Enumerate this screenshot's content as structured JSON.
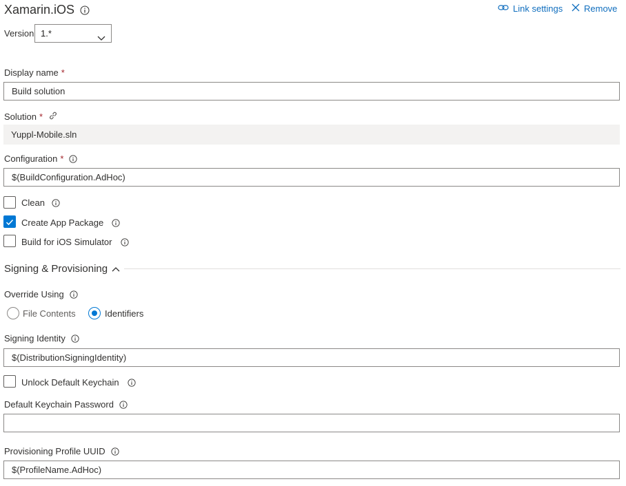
{
  "task": {
    "title": "Xamarin.iOS",
    "link_settings": "Link settings",
    "remove": "Remove"
  },
  "version": {
    "label": "Version",
    "value": "1.*"
  },
  "display_name": {
    "label": "Display name",
    "required_mark": "*",
    "value": "Build solution"
  },
  "solution": {
    "label": "Solution",
    "required_mark": "*",
    "value": "Yuppl-Mobile.sln"
  },
  "configuration": {
    "label": "Configuration",
    "required_mark": "*",
    "value": "$(BuildConfiguration.AdHoc)"
  },
  "options": {
    "clean": {
      "label": "Clean",
      "checked": false
    },
    "create_app_package": {
      "label": "Create App Package",
      "checked": true
    },
    "build_for_simulator": {
      "label": "Build for iOS Simulator",
      "checked": false
    }
  },
  "signing": {
    "section_title": "Signing & Provisioning",
    "override_using": {
      "label": "Override Using",
      "options": [
        "File Contents",
        "Identifiers"
      ],
      "selected": "Identifiers"
    },
    "signing_identity": {
      "label": "Signing Identity",
      "value": "$(DistributionSigningIdentity)"
    },
    "unlock_keychain": {
      "label": "Unlock Default Keychain",
      "checked": false
    },
    "keychain_password": {
      "label": "Default Keychain Password",
      "value": ""
    },
    "provisioning_uuid": {
      "label": "Provisioning Profile UUID",
      "value": "$(ProfileName.AdHoc)"
    }
  },
  "colors": {
    "accent": "#0078d4",
    "link": "#106ebe",
    "required": "#a4262c",
    "readonly_bg": "#f3f2f1"
  },
  "icons": [
    "info-icon",
    "link-icon",
    "remove-icon",
    "chevron-down-icon",
    "chevron-up-icon",
    "checkmark-icon",
    "chain-link-icon"
  ]
}
